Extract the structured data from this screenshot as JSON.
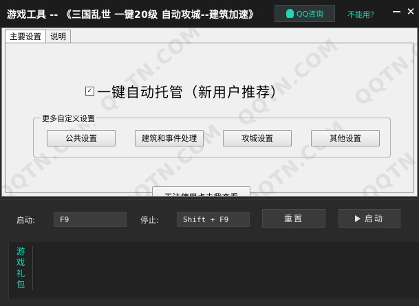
{
  "titlebar": {
    "title": "游戏工具 -- 《三国乱世 一键20级 自动攻城--建筑加速》",
    "qq_button": "QQ咨询",
    "cant_use_link": "不能用？",
    "close_symbol": "✕"
  },
  "tabs": [
    {
      "label": "主要设置",
      "active": true
    },
    {
      "label": "说明",
      "active": false
    }
  ],
  "main": {
    "auto_checkbox_checked": true,
    "auto_label": "一键自动托管（新用户推荐）",
    "group_title": "更多自定义设置",
    "buttons": {
      "public": "公共设置",
      "building": "建筑和事件处理",
      "siege": "攻城设置",
      "other": "其他设置"
    },
    "help_button": "无法使用点击我查看"
  },
  "hotkeys": {
    "start_label": "启动:",
    "start_value": "F9",
    "stop_label": "停止:",
    "stop_value": "Shift + F9",
    "reset_button": "重置",
    "start_button": "启动"
  },
  "gift": {
    "label": "游戏礼包"
  },
  "watermark_text": "QQTN.COM",
  "colors": {
    "accent": "#21d6b8",
    "titlebar_bg": "#1c1c1c",
    "panel_bg": "#f0f0f0",
    "dark_bg": "#2a2a2a"
  },
  "icons": [
    "qq-penguin-icon",
    "play-icon",
    "minimize-icon",
    "close-icon",
    "check-icon"
  ]
}
